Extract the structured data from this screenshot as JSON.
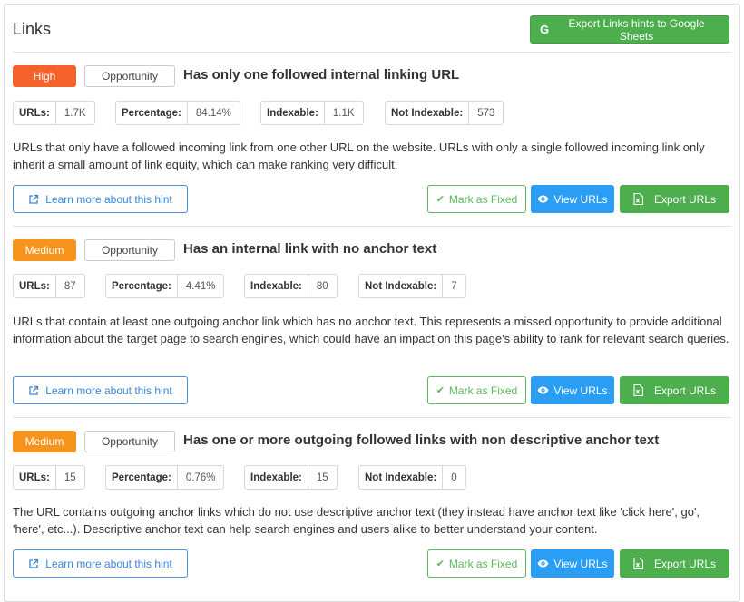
{
  "header": {
    "title": "Links",
    "export_sheets_icon": "google-g-icon",
    "export_sheets_label": "Export Links hints to Google Sheets"
  },
  "hints": [
    {
      "priority": "High",
      "type": "Opportunity",
      "title": "Has only one followed internal linking URL",
      "stats": [
        {
          "label": "URLs:",
          "value": "1.7K"
        },
        {
          "label": "Percentage:",
          "value": "84.14%"
        },
        {
          "label": "Indexable:",
          "value": "1.1K"
        },
        {
          "label": "Not Indexable:",
          "value": "573"
        }
      ],
      "description": "URLs that only have a followed incoming link from one other URL on the website. URLs with only a single followed incoming link only inherit a small amount of link equity, which can make ranking very difficult.",
      "learn_more": "Learn more about this hint",
      "mark_fixed": "Mark as Fixed",
      "view_urls": "View URLs",
      "export_urls": "Export URLs"
    },
    {
      "priority": "Medium",
      "type": "Opportunity",
      "title": "Has an internal link with no anchor text",
      "stats": [
        {
          "label": "URLs:",
          "value": "87"
        },
        {
          "label": "Percentage:",
          "value": "4.41%"
        },
        {
          "label": "Indexable:",
          "value": "80"
        },
        {
          "label": "Not Indexable:",
          "value": "7"
        }
      ],
      "description": "URLs that contain at least one outgoing anchor link which has no anchor text. This represents a missed opportunity to provide additional information about the target page to search engines, which could have an impact on this page's ability to rank for relevant search queries.",
      "learn_more": "Learn more about this hint",
      "mark_fixed": "Mark as Fixed",
      "view_urls": "View URLs",
      "export_urls": "Export URLs"
    },
    {
      "priority": "Medium",
      "type": "Opportunity",
      "title": "Has one or more outgoing followed links with non descriptive anchor text",
      "stats": [
        {
          "label": "URLs:",
          "value": "15"
        },
        {
          "label": "Percentage:",
          "value": "0.76%"
        },
        {
          "label": "Indexable:",
          "value": "15"
        },
        {
          "label": "Not Indexable:",
          "value": "0"
        }
      ],
      "description": "The URL contains outgoing anchor links which do not use descriptive anchor text (they instead have anchor text like 'click here', go', 'here', etc...). Descriptive anchor text can help search engines and users alike to better understand your content.",
      "learn_more": "Learn more about this hint",
      "mark_fixed": "Mark as Fixed",
      "view_urls": "View URLs",
      "export_urls": "Export URLs"
    }
  ],
  "colors": {
    "high": "#f4612b",
    "medium": "#f7941d",
    "green": "#4cae4c",
    "blue": "#2a9df4",
    "link_blue": "#3a87d6"
  }
}
